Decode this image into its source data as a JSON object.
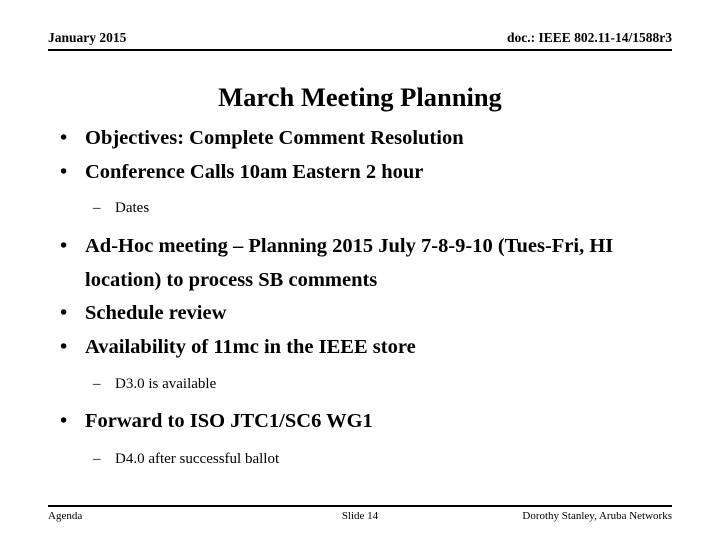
{
  "header": {
    "left": "January 2015",
    "right": "doc.: IEEE 802.11-14/1588r3"
  },
  "title": "March Meeting Planning",
  "bullet_glyph": "•",
  "dash_glyph": "–",
  "content": [
    {
      "level": 1,
      "text": "Objectives: Complete Comment Resolution"
    },
    {
      "level": 1,
      "text": "Conference Calls 10am Eastern  2 hour"
    },
    {
      "level": 2,
      "text": "Dates"
    },
    {
      "level": 1,
      "text": "Ad-Hoc meeting – Planning 2015 July 7-8-9-10 (Tues-Fri, HI location) to process SB comments"
    },
    {
      "level": 1,
      "text": "Schedule review"
    },
    {
      "level": 1,
      "text": "Availability of 11mc in the IEEE store"
    },
    {
      "level": 2,
      "text": "D3.0 is available"
    },
    {
      "level": 1,
      "text": "Forward to ISO JTC1/SC6 WG1"
    },
    {
      "level": 2,
      "text": "D4.0 after successful ballot"
    }
  ],
  "footer": {
    "left": "Agenda",
    "center": "Slide 14",
    "right": "Dorothy Stanley, Aruba Networks"
  }
}
